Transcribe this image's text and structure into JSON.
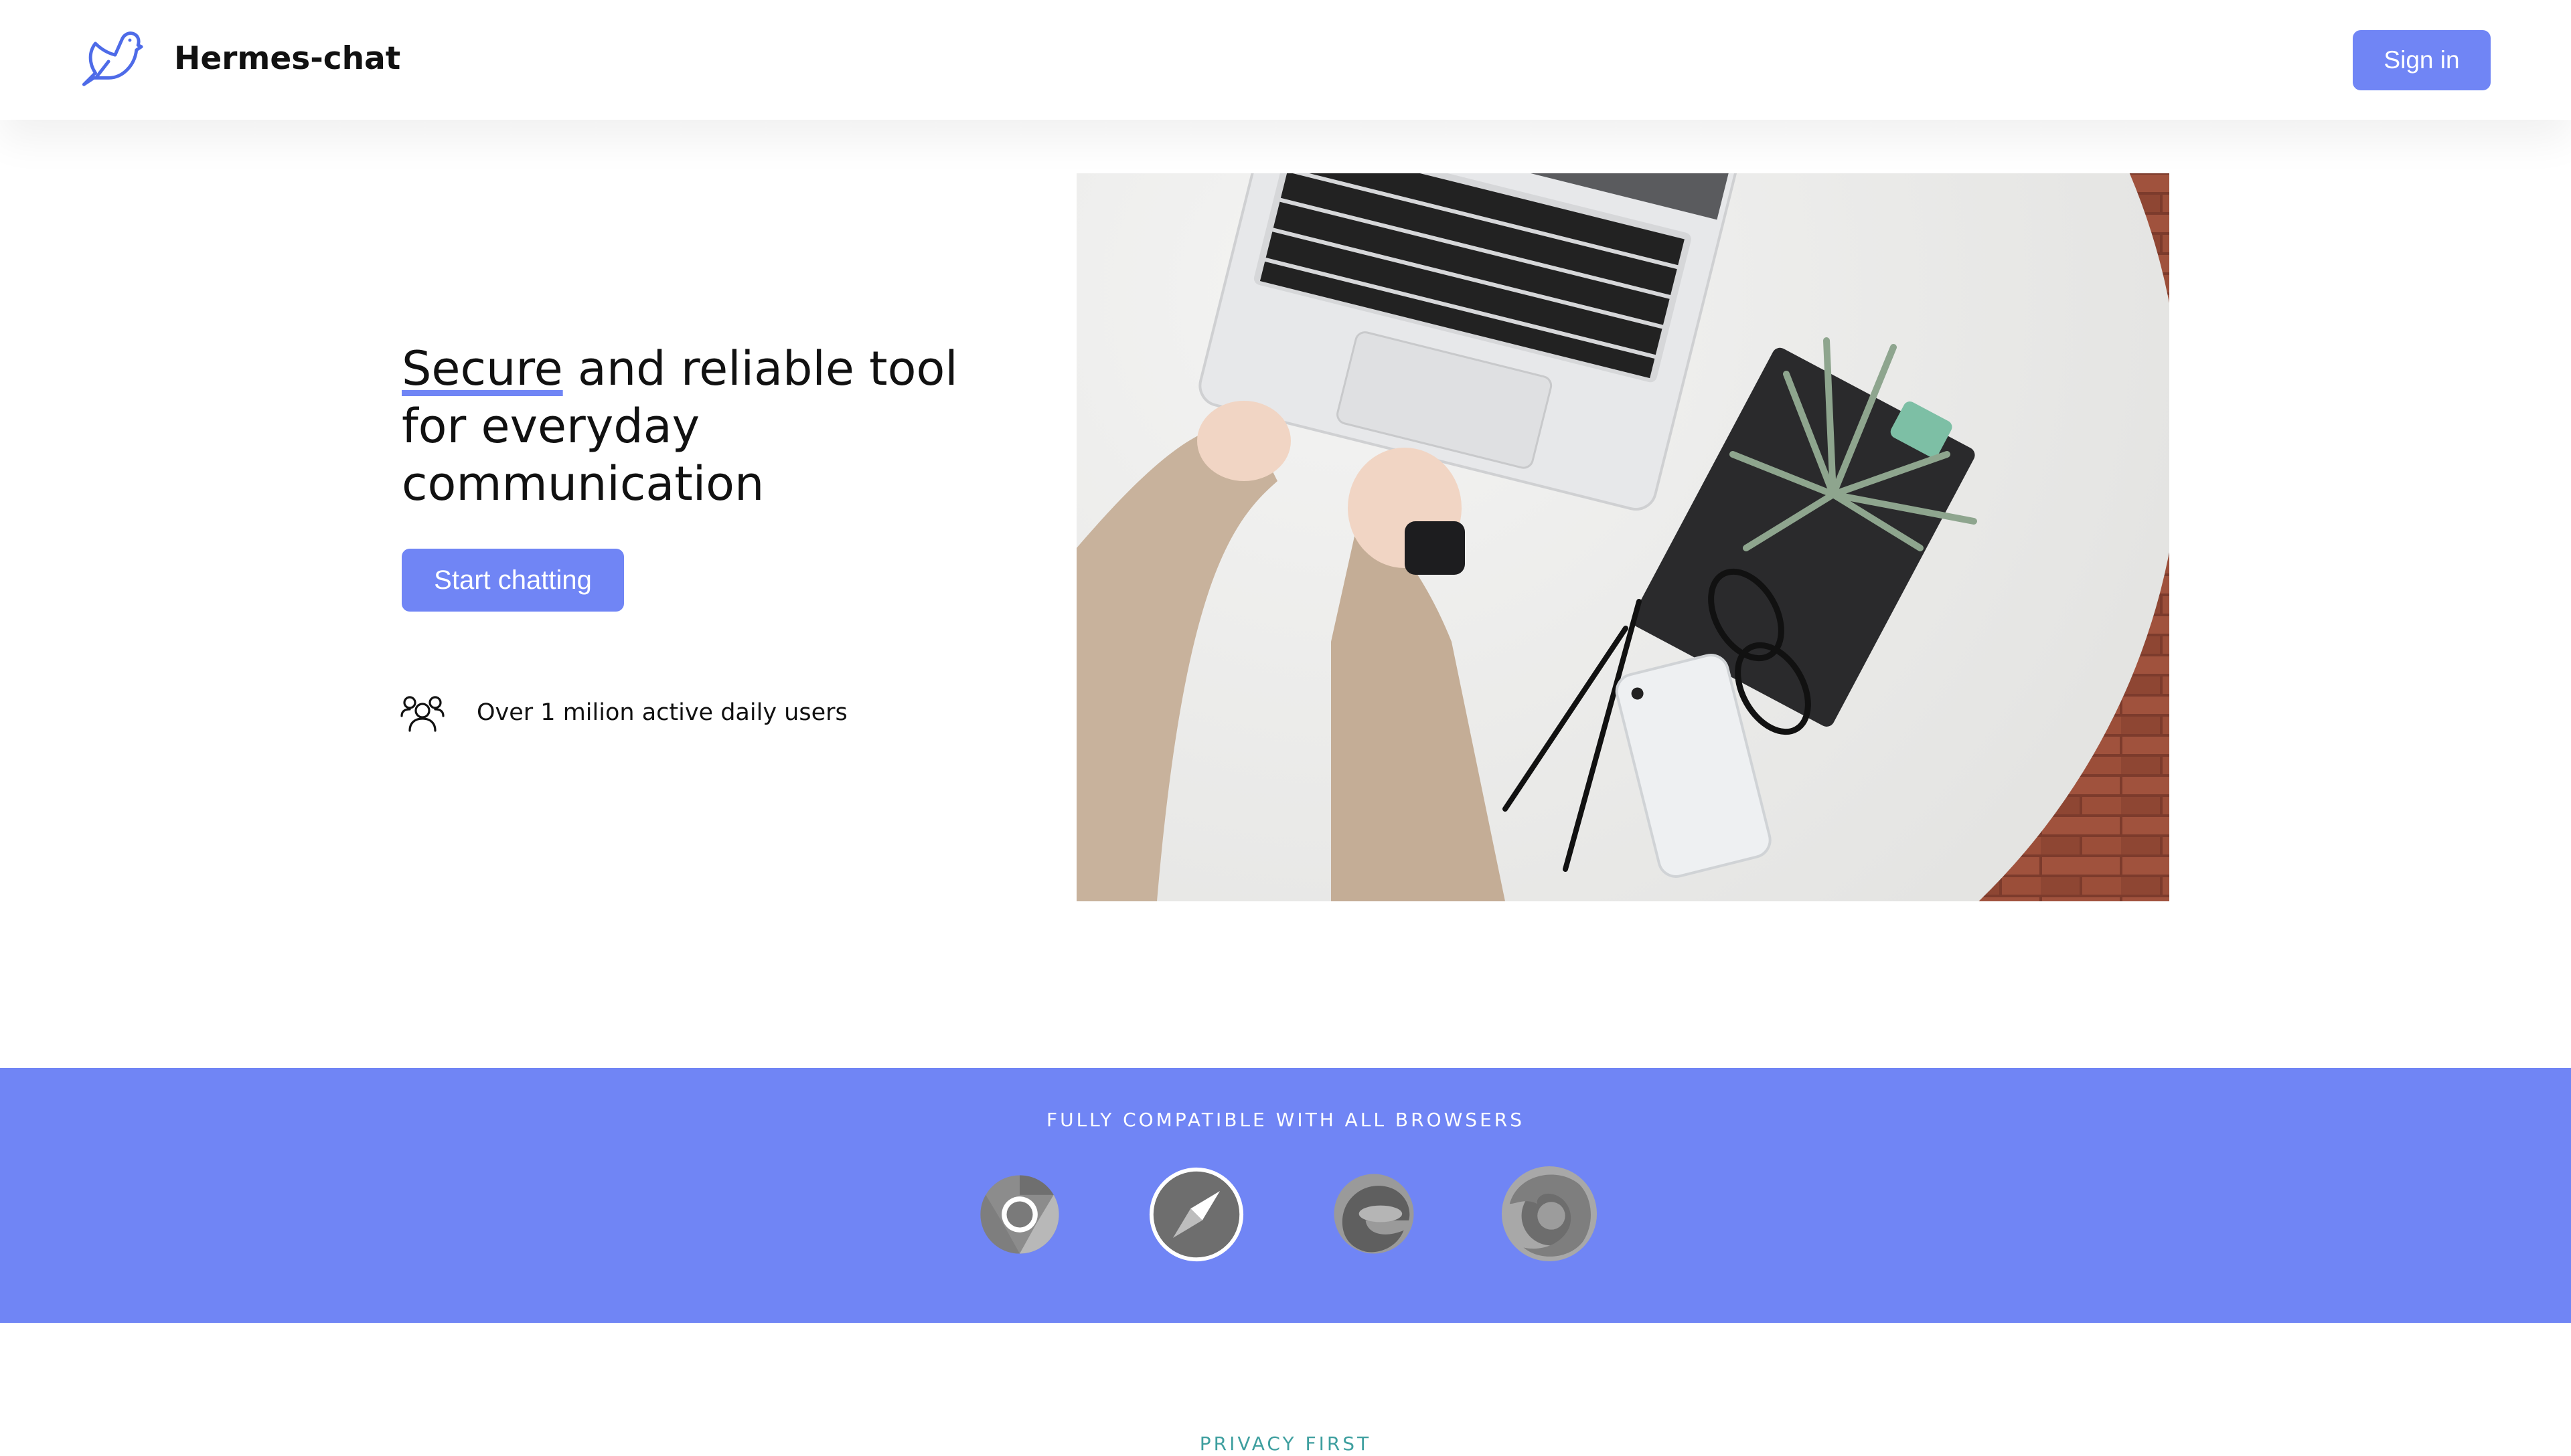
{
  "header": {
    "brand": "Hermes-chat",
    "logo_icon": "bird-icon",
    "signin_label": "Sign in"
  },
  "hero": {
    "title_accent": "Secure",
    "title_rest": " and reliable tool for everyday communication",
    "cta_label": "Start chatting",
    "users_icon": "users-icon",
    "users_text": "Over 1 milion active daily users",
    "image": "laptop-desk-photo"
  },
  "browsers": {
    "title": "FULLY COMPATIBLE WITH ALL BROWSERS",
    "items": [
      {
        "icon": "chrome-icon"
      },
      {
        "icon": "safari-icon"
      },
      {
        "icon": "edge-icon"
      },
      {
        "icon": "firefox-icon"
      }
    ]
  },
  "next_section": {
    "eyebrow": "PRIVACY FIRST"
  },
  "colors": {
    "accent": "#7085f5",
    "text": "#111111",
    "background": "#ffffff"
  }
}
